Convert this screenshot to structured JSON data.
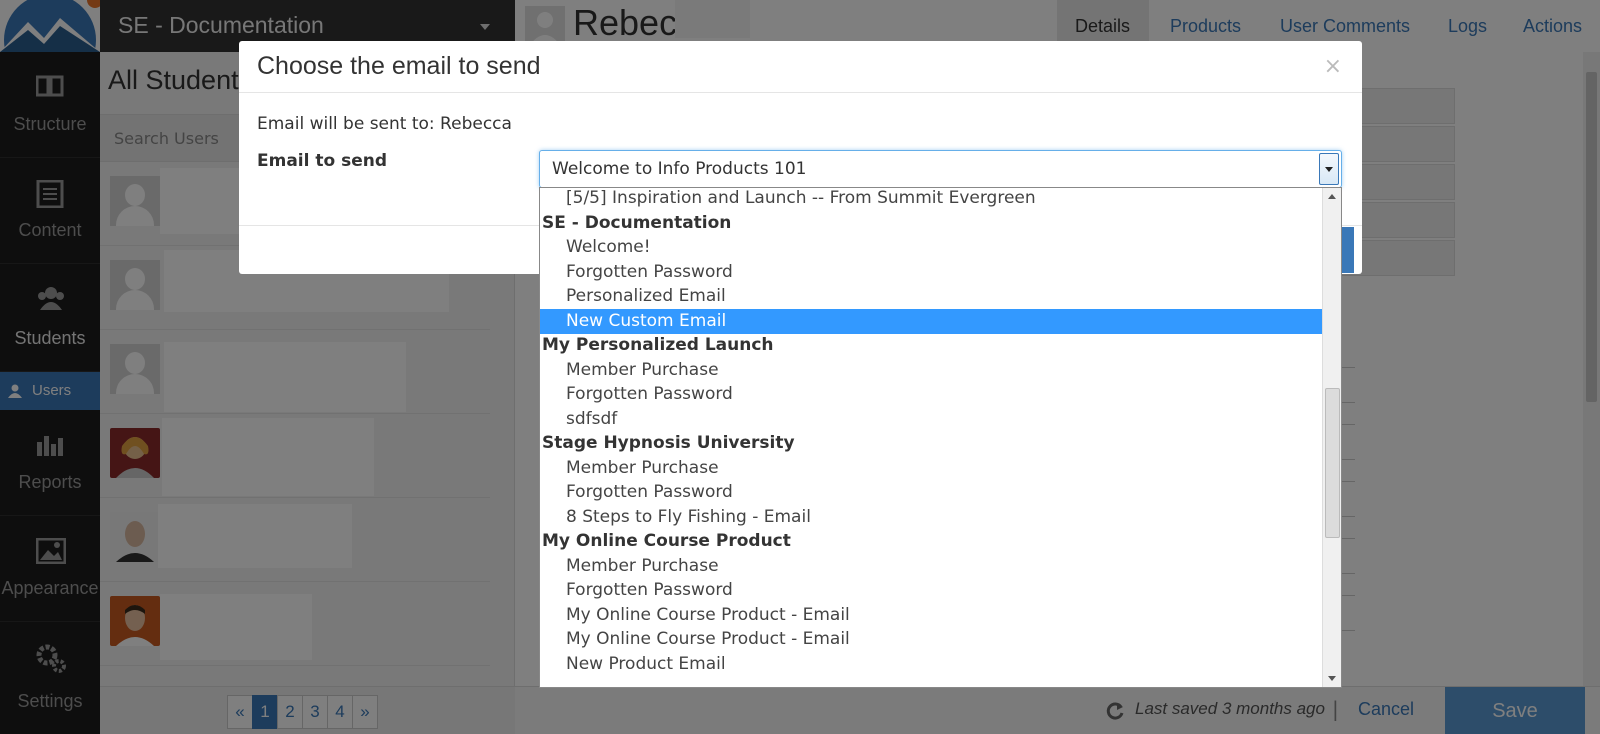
{
  "sidebar": {
    "items": [
      {
        "label": "Structure",
        "icon": "structure-icon"
      },
      {
        "label": "Content",
        "icon": "content-icon"
      },
      {
        "label": "Students",
        "icon": "students-icon"
      },
      {
        "label": "Reports",
        "icon": "reports-icon"
      },
      {
        "label": "Appearance",
        "icon": "appearance-icon"
      },
      {
        "label": "Settings",
        "icon": "settings-icon"
      }
    ],
    "subnav_label": "Users"
  },
  "topbar": {
    "site_title": "SE - Documentation"
  },
  "students": {
    "heading": "All Students",
    "search_placeholder": "Search Users",
    "pagination": {
      "prev": "«",
      "pages": [
        "1",
        "2",
        "3",
        "4"
      ],
      "next": "»",
      "current": "1"
    }
  },
  "profile": {
    "name": "Rebecca",
    "tabs": [
      "Details",
      "Products",
      "User Comments",
      "Logs",
      "Actions"
    ],
    "active_tab": "Details"
  },
  "footer": {
    "last_saved": "Last saved 3 months ago",
    "cancel_label": "Cancel",
    "save_label": "Save"
  },
  "modal": {
    "title": "Choose the email to send",
    "close_label": "×",
    "recipient_text": "Email will be sent to: Rebecca",
    "field_label": "Email to send",
    "selected_value": "Welcome to Info Products 101",
    "options": [
      {
        "label": "[5/5] Inspiration and Launch -- From Summit Evergreen",
        "group": false
      },
      {
        "label": "SE - Documentation",
        "group": true
      },
      {
        "label": "Welcome!",
        "group": false
      },
      {
        "label": "Forgotten Password",
        "group": false
      },
      {
        "label": "Personalized Email",
        "group": false
      },
      {
        "label": "New Custom Email",
        "group": false,
        "highlighted": true
      },
      {
        "label": "My Personalized Launch",
        "group": true
      },
      {
        "label": "Member Purchase",
        "group": false
      },
      {
        "label": "Forgotten Password",
        "group": false
      },
      {
        "label": "sdfsdf",
        "group": false
      },
      {
        "label": "Stage Hypnosis University",
        "group": true
      },
      {
        "label": "Member Purchase",
        "group": false
      },
      {
        "label": "Forgotten Password",
        "group": false
      },
      {
        "label": "8 Steps to Fly Fishing - Email",
        "group": false
      },
      {
        "label": "My Online Course Product",
        "group": true
      },
      {
        "label": "Member Purchase",
        "group": false
      },
      {
        "label": "Forgotten Password",
        "group": false
      },
      {
        "label": "My Online Course Product - Email",
        "group": false
      },
      {
        "label": "My Online Course Product - Email",
        "group": false
      },
      {
        "label": "New Product Email",
        "group": false
      }
    ]
  },
  "colors": {
    "accent": "#3a78b8",
    "highlight": "#3399ff",
    "sidebar_bg": "#1c1c1c"
  }
}
